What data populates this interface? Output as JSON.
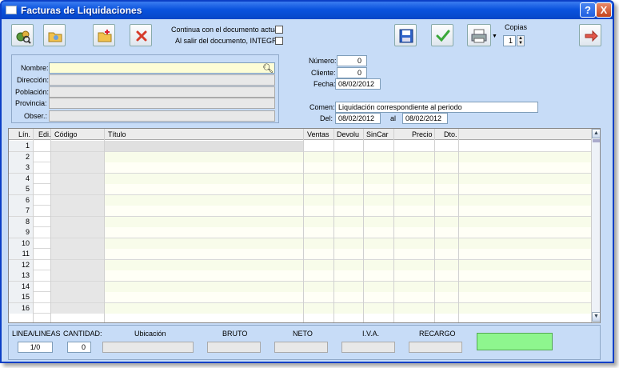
{
  "window": {
    "title": "Facturas de Liquidaciones",
    "help_label": "?",
    "close_label": "X"
  },
  "toolbar": {
    "items": [
      {
        "icon": "search-people-icon"
      },
      {
        "icon": "folder-open-icon"
      },
      {
        "icon": "new-document-icon"
      },
      {
        "icon": "delete-icon"
      },
      {
        "icon": "save-icon"
      },
      {
        "icon": "accept-check-icon"
      },
      {
        "icon": "printer-icon"
      },
      {
        "icon": "exit-arrow-icon"
      }
    ],
    "option_continue": "Continua con el documento actual",
    "option_integra": "Al salir del documento, INTEGRA",
    "copies_label": "Copias",
    "copies_value": "1"
  },
  "customer": {
    "labels": {
      "nombre": "Nombre:",
      "direccion": "Dirección:",
      "poblacion": "Población:",
      "provincia": "Provincia:",
      "obser": "Obser.:"
    },
    "values": {
      "nombre": "",
      "direccion": "",
      "poblacion": "",
      "provincia": "",
      "obser": ""
    }
  },
  "document": {
    "numero_label": "Número:",
    "numero_value": "0",
    "cliente_label": "Cliente:",
    "cliente_value": "0",
    "fecha_label": "Fecha:",
    "fecha_value": "08/02/2012",
    "comen_label": "Comen:",
    "comen_value": "Liquidación correspondiente al periodo",
    "del_label": "Del:",
    "del_value": "08/02/2012",
    "al_label": "al",
    "al_value": "08/02/2012"
  },
  "grid": {
    "columns": [
      "Lín.",
      "Edi.",
      "Código",
      "Título",
      "Ventas",
      "Devolu",
      "SinCar",
      "Precio",
      "Dto."
    ],
    "row_numbers": [
      "1",
      "2",
      "3",
      "4",
      "5",
      "6",
      "7",
      "8",
      "9",
      "10",
      "11",
      "12",
      "13",
      "14",
      "15",
      "16"
    ]
  },
  "totals": {
    "linea_label": "LINEA/LINEAS",
    "linea_value": "1/0",
    "cantidad_label": "CANTIDAD:",
    "cantidad_value": "0",
    "ubicacion_label": "Ubicación",
    "ubicacion_value": "",
    "bruto_label": "BRUTO",
    "bruto_value": "",
    "neto_label": "NETO",
    "neto_value": "",
    "iva_label": "I.V.A.",
    "iva_value": "",
    "recargo_label": "RECARGO",
    "recargo_value": "",
    "total_value": "",
    "total_color": "#8ef68e"
  }
}
